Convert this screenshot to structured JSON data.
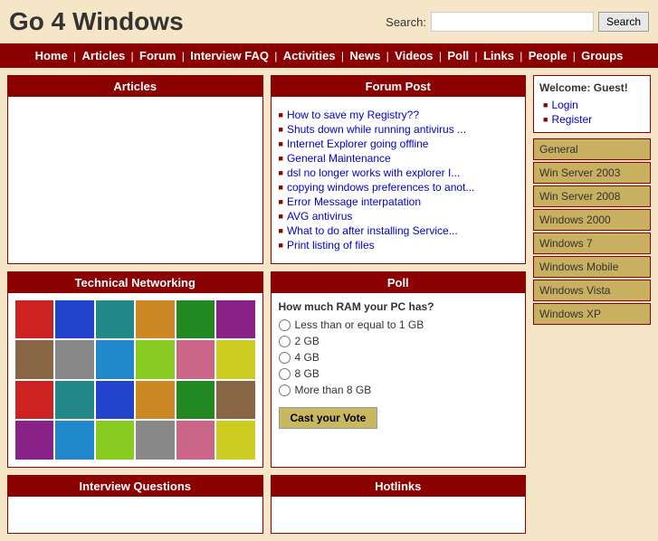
{
  "site": {
    "title": "Go 4 Windows",
    "search_label": "Search:",
    "search_placeholder": "",
    "search_button": "Search"
  },
  "navbar": {
    "items": [
      {
        "label": "Home",
        "href": "#"
      },
      {
        "label": "Articles",
        "href": "#"
      },
      {
        "label": "Forum",
        "href": "#"
      },
      {
        "label": "Interview FAQ",
        "href": "#"
      },
      {
        "label": "Activities",
        "href": "#"
      },
      {
        "label": "News",
        "href": "#"
      },
      {
        "label": "Videos",
        "href": "#"
      },
      {
        "label": "Poll",
        "href": "#"
      },
      {
        "label": "Links",
        "href": "#"
      },
      {
        "label": "People",
        "href": "#"
      },
      {
        "label": "Groups",
        "href": "#"
      }
    ]
  },
  "articles": {
    "header": "Articles",
    "body": ""
  },
  "forum": {
    "header": "Forum Post",
    "items": [
      "How to save my Registry??",
      "Shuts down while running antivirus ...",
      "Internet Explorer going offline",
      "General Maintenance",
      "dsl no longer works with explorer I...",
      "copying windows preferences to anot...",
      "Error Message interpatation",
      "AVG antivirus",
      "What to do after installing Service...",
      "Print listing of files"
    ]
  },
  "tech": {
    "header": "Technical Networking",
    "images": [
      {
        "color": "img-red",
        "label": "img1"
      },
      {
        "color": "img-blue",
        "label": "img2"
      },
      {
        "color": "img-teal",
        "label": "img3"
      },
      {
        "color": "img-orange",
        "label": "img4"
      },
      {
        "color": "img-green",
        "label": "img5"
      },
      {
        "color": "img-purple",
        "label": "img6"
      },
      {
        "color": "img-brown",
        "label": "img7"
      },
      {
        "color": "img-gray",
        "label": "img8"
      },
      {
        "color": "img-sky",
        "label": "img9"
      },
      {
        "color": "img-lime",
        "label": "img10"
      },
      {
        "color": "img-pink",
        "label": "img11"
      },
      {
        "color": "img-yellow",
        "label": "img12"
      },
      {
        "color": "img-red",
        "label": "img13"
      },
      {
        "color": "img-teal",
        "label": "img14"
      },
      {
        "color": "img-blue",
        "label": "img15"
      },
      {
        "color": "img-orange",
        "label": "img16"
      },
      {
        "color": "img-green",
        "label": "img17"
      },
      {
        "color": "img-brown",
        "label": "img18"
      },
      {
        "color": "img-purple",
        "label": "img19"
      },
      {
        "color": "img-sky",
        "label": "img20"
      },
      {
        "color": "img-lime",
        "label": "img21"
      },
      {
        "color": "img-gray",
        "label": "img22"
      },
      {
        "color": "img-pink",
        "label": "img23"
      },
      {
        "color": "img-yellow",
        "label": "img24"
      }
    ]
  },
  "poll": {
    "header": "Poll",
    "question": "How much RAM your PC has?",
    "options": [
      "Less than or equal to 1 GB",
      "2 GB",
      "4 GB",
      "8 GB",
      "More than 8 GB"
    ],
    "vote_button": "Cast your Vote"
  },
  "interview": {
    "header": "Interview Questions"
  },
  "hotlinks": {
    "header": "Hotlinks"
  },
  "sidebar": {
    "welcome_title": "Welcome: Guest!",
    "login_label": "Login",
    "register_label": "Register",
    "categories": [
      "General",
      "Win Server 2003",
      "Win Server 2008",
      "Windows 2000",
      "Windows 7",
      "Windows Mobile",
      "Windows Vista",
      "Windows XP"
    ]
  }
}
